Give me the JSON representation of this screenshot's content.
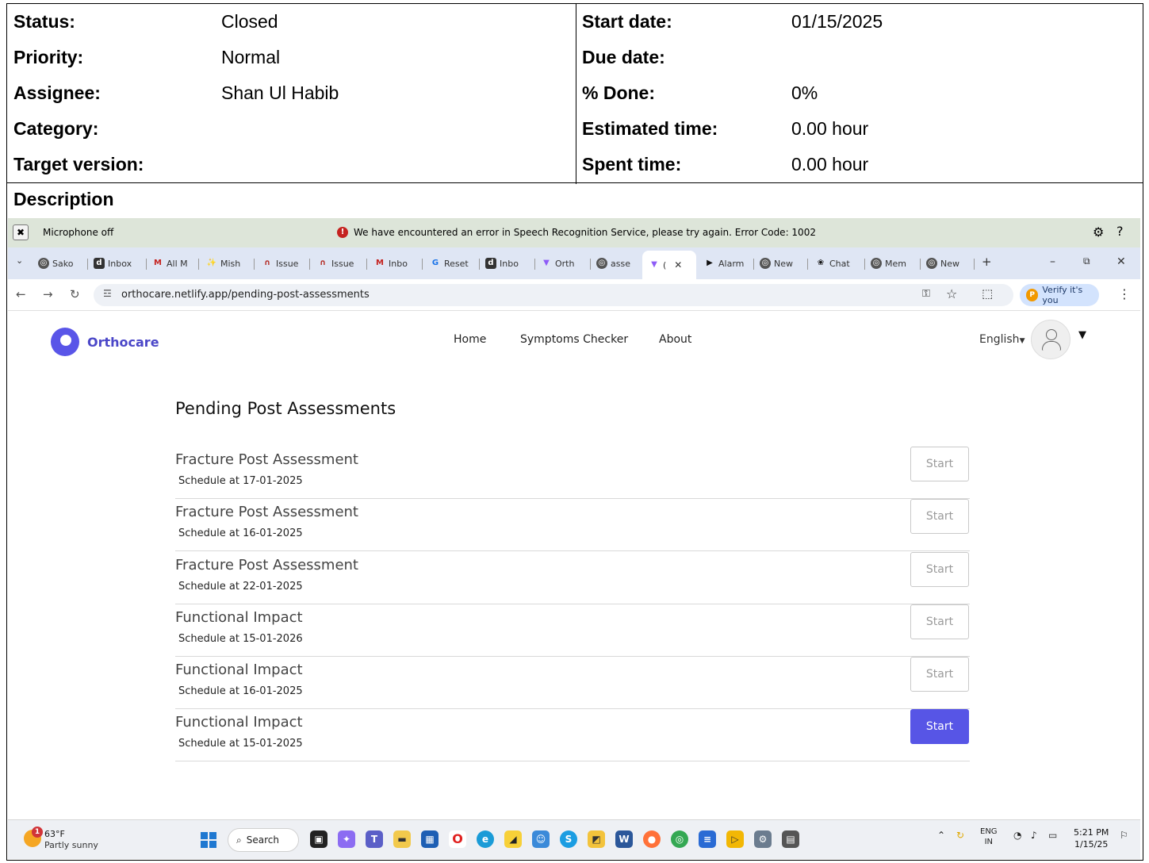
{
  "attributes": {
    "left": [
      {
        "key": "Status:",
        "value": "Closed"
      },
      {
        "key": "Priority:",
        "value": "Normal"
      },
      {
        "key": "Assignee:",
        "value": "Shan Ul Habib"
      },
      {
        "key": "Category:",
        "value": ""
      },
      {
        "key": "Target version:",
        "value": ""
      }
    ],
    "right": [
      {
        "key": "Start date:",
        "value": "01/15/2025"
      },
      {
        "key": "Due date:",
        "value": ""
      },
      {
        "key": "% Done:",
        "value": "0%"
      },
      {
        "key": "Estimated time:",
        "value": "0.00 hour"
      },
      {
        "key": "Spent time:",
        "value": "0.00 hour"
      }
    ]
  },
  "description_label": "Description",
  "browser": {
    "mic_bar": {
      "mic_text": "Microphone off",
      "error_text": "We have encountered an error in Speech Recognition Service, please try again. Error Code: 1002"
    },
    "tabs": [
      {
        "label": "Sako",
        "icon": "globe-icon"
      },
      {
        "label": "Inbox",
        "icon": "inbox-app-icon"
      },
      {
        "label": "All M",
        "icon": "gmail-icon"
      },
      {
        "label": "Mish",
        "icon": "mishra-icon"
      },
      {
        "label": "Issue",
        "icon": "redmine-icon"
      },
      {
        "label": "Issue",
        "icon": "redmine-icon"
      },
      {
        "label": "Inbo",
        "icon": "gmail-icon"
      },
      {
        "label": "Reset",
        "icon": "google-icon"
      },
      {
        "label": "Inbo",
        "icon": "inbox-app-icon"
      },
      {
        "label": "Orth",
        "icon": "vite-icon"
      },
      {
        "label": "asse",
        "icon": "globe-icon"
      },
      {
        "label": "(",
        "icon": "vite-icon",
        "active": true
      },
      {
        "label": "Alarm",
        "icon": "play-icon"
      },
      {
        "label": "New",
        "icon": "globe-icon"
      },
      {
        "label": "Chat",
        "icon": "chatgpt-icon"
      },
      {
        "label": "Mem",
        "icon": "globe-icon"
      },
      {
        "label": "New",
        "icon": "globe-icon"
      }
    ],
    "url": "orthocare.netlify.app/pending-post-assessments",
    "verify_label": "Verify it's you",
    "profile_initial": "P"
  },
  "site": {
    "brand": "Orthocare",
    "nav": [
      "Home",
      "Symptoms Checker",
      "About"
    ],
    "language": "English",
    "heading": "Pending Post Assessments",
    "assessments": [
      {
        "title": "Fracture Post Assessment",
        "schedule": "Schedule at 17-01-2025",
        "button": "Start",
        "enabled": false
      },
      {
        "title": "Fracture Post Assessment",
        "schedule": "Schedule at 16-01-2025",
        "button": "Start",
        "enabled": false
      },
      {
        "title": "Fracture Post Assessment",
        "schedule": "Schedule at 22-01-2025",
        "button": "Start",
        "enabled": false
      },
      {
        "title": "Functional Impact",
        "schedule": "Schedule at 15-01-2026",
        "button": "Start",
        "enabled": false
      },
      {
        "title": "Functional Impact",
        "schedule": "Schedule at 16-01-2025",
        "button": "Start",
        "enabled": false
      },
      {
        "title": "Functional Impact",
        "schedule": "Schedule at 15-01-2025",
        "button": "Start",
        "enabled": true
      }
    ],
    "accent_color": "#5755e6"
  },
  "taskbar": {
    "weather_temp": "63°F",
    "weather_condition": "Partly sunny",
    "weather_badge": "1",
    "search_label": "Search",
    "lang_top": "ENG",
    "lang_bottom": "IN",
    "time": "5:21 PM",
    "date": "1/15/25"
  }
}
